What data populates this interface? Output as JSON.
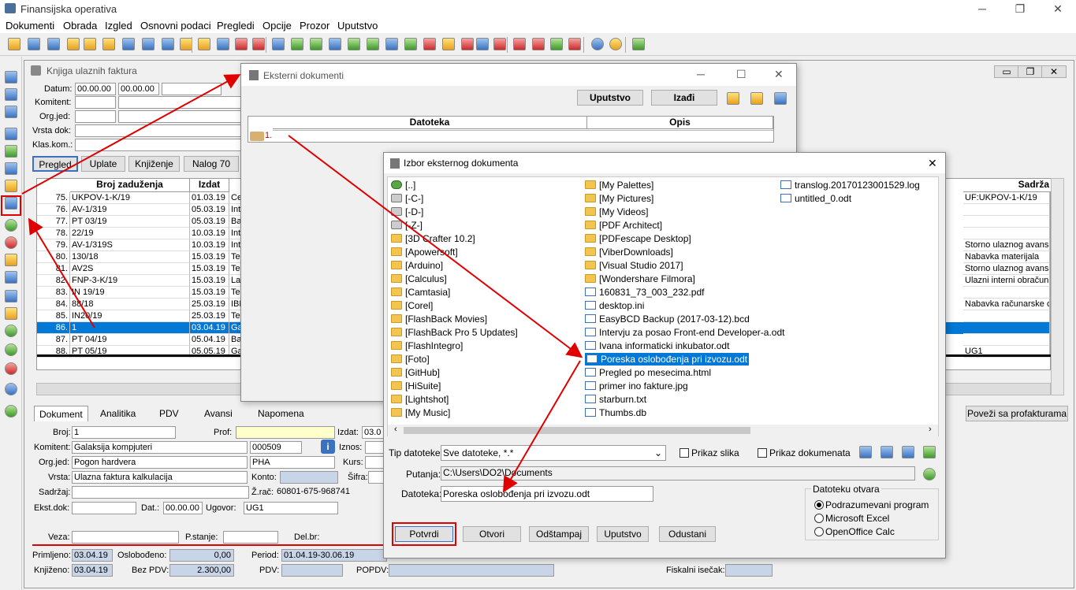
{
  "app": {
    "title": "Finansijska operativa",
    "win_min": "─",
    "win_max": "❐",
    "win_close": "✕"
  },
  "menu": [
    "Dokumenti",
    "Obrada",
    "Izgled",
    "Osnovni podaci",
    "Pregledi",
    "Opcije",
    "Prozor",
    "Uputstvo"
  ],
  "kuf": {
    "title": "Knjiga ulaznih faktura",
    "filter": {
      "datum_label": "Datum:",
      "datum_from": "00.00.00",
      "datum_to": "00.00.00",
      "komitent_label": "Komitent:",
      "orgjed_label": "Org.jed:",
      "vrsta_label": "Vrsta dok:",
      "klas_label": "Klas.kom.:"
    },
    "buttons": [
      "Pregled",
      "Uplate",
      "Knjiženje",
      "Nalog 70"
    ],
    "columns": {
      "broj": "Broj zaduženja",
      "izdat": "Izdat",
      "sadrzaj": "Sadrža"
    },
    "rows": [
      {
        "n": "75.",
        "broj": "UKPOV-1-K/19",
        "izdat": "01.03.19",
        "k": "Cer",
        "s": "UF:UKPOV-1-K/19"
      },
      {
        "n": "76.",
        "broj": "AV-1/319",
        "izdat": "05.03.19",
        "k": "Inte",
        "s": ""
      },
      {
        "n": "77.",
        "broj": "PT 03/19",
        "izdat": "05.03.19",
        "k": "Ban",
        "s": ""
      },
      {
        "n": "78.",
        "broj": "22/19",
        "izdat": "10.03.19",
        "k": "Inte",
        "s": ""
      },
      {
        "n": "79.",
        "broj": "AV-1/319S",
        "izdat": "10.03.19",
        "k": "Inte",
        "s": "Storno ulaznog avansa"
      },
      {
        "n": "80.",
        "broj": "130/18",
        "izdat": "15.03.19",
        "k": "Teh",
        "s": "Nabavka materijala"
      },
      {
        "n": "81.",
        "broj": "AV2S",
        "izdat": "15.03.19",
        "k": "Teh",
        "s": "Storno ulaznog avansa"
      },
      {
        "n": "82.",
        "broj": "FNP-3-K/19",
        "izdat": "15.03.19",
        "k": "Lar",
        "s": "Ulazni interni obračun P"
      },
      {
        "n": "83.",
        "broj": "IN 19/19",
        "izdat": "15.03.19",
        "k": "Teh",
        "s": ""
      },
      {
        "n": "84.",
        "broj": "88/18",
        "izdat": "25.03.19",
        "k": "IBM",
        "s": "Nabavka računarske op"
      },
      {
        "n": "85.",
        "broj": "IN20/19",
        "izdat": "25.03.19",
        "k": "Teh",
        "s": ""
      },
      {
        "n": "86.",
        "broj": "1",
        "izdat": "03.04.19",
        "k": "Gal",
        "s": ""
      },
      {
        "n": "87.",
        "broj": "PT 04/19",
        "izdat": "05.04.19",
        "k": "Ban",
        "s": ""
      },
      {
        "n": "88.",
        "broj": "PT 05/19",
        "izdat": "05.05.19",
        "k": "Gal",
        "s": "UG1"
      }
    ],
    "tabs": [
      "Dokument",
      "Analitika",
      "PDV",
      "Avansi",
      "Napomena"
    ],
    "povezi_btn": "Poveži sa profakturama",
    "form": {
      "broj_label": "Broj:",
      "broj": "1",
      "prof_label": "Prof:",
      "izdat_label": "Izdat:",
      "izdat": "03.0",
      "komitent_label": "Komitent:",
      "komitent": "Galaksija kompjuteri",
      "komitent_code": "000509",
      "iznos_label": "Iznos:",
      "orgjed_label": "Org.jed:",
      "orgjed": "Pogon hardvera",
      "orgjed_code": "PHA",
      "kurs_label": "Kurs:",
      "vrsta_label": "Vrsta:",
      "vrsta": "Ulazna faktura kalkulacija",
      "konto_label": "Konto:",
      "sifra_label": "Šifra:",
      "sadrzaj_label": "Sadržaj:",
      "zrac_label": "Ž.rač:",
      "zrac": "60801-675-968741",
      "ekst_label": "Ekst.dok:",
      "dat_label": "Dat.:",
      "dat": "00.00.00",
      "ugovor_label": "Ugovor:",
      "ugovor": "UG1",
      "veza_label": "Veza:",
      "pstanje_label": "P.stanje:",
      "delbr_label": "Del.br:",
      "primljeno_label": "Primljeno:",
      "primljeno": "03.04.19",
      "oslobodjeno_label": "Oslobođeno:",
      "oslobodjeno": "0,00",
      "period_label": "Period:",
      "period": "01.04.19-30.06.19",
      "knjizeno_label": "Knjiženo:",
      "knjizeno": "03.04.19",
      "bezpdv_label": "Bez PDV:",
      "bezpdv": "2.300,00",
      "pdv_label": "PDV:",
      "popdv_label": "POPDV:",
      "fiskalni_label": "Fiskalni isečak:"
    }
  },
  "eksterni": {
    "title": "Eksterni dokumenti",
    "buttons": [
      "Uputstvo",
      "Izađi"
    ],
    "col_datoteka": "Datoteka",
    "col_opis": "Opis",
    "row_num": "1."
  },
  "izbor": {
    "title": "Izbor eksternog dokumenta",
    "col1": [
      [
        "up",
        "[..]"
      ],
      [
        "drive",
        "[-C-]"
      ],
      [
        "drive",
        "[-D-]"
      ],
      [
        "drive",
        "[-Z-]"
      ],
      [
        "folder",
        "[3D Crafter 10.2]"
      ],
      [
        "folder",
        "[Apowersoft]"
      ],
      [
        "folder",
        "[Arduino]"
      ],
      [
        "folder",
        "[Calculus]"
      ],
      [
        "folder",
        "[Camtasia]"
      ],
      [
        "folder",
        "[Corel]"
      ],
      [
        "folder",
        "[FlashBack Movies]"
      ],
      [
        "folder",
        "[FlashBack Pro 5 Updates]"
      ],
      [
        "folder",
        "[FlashIntegro]"
      ],
      [
        "folder",
        "[Foto]"
      ],
      [
        "folder",
        "[GitHub]"
      ],
      [
        "folder",
        "[HiSuite]"
      ],
      [
        "folder",
        "[Lightshot]"
      ],
      [
        "folder",
        "[My Music]"
      ]
    ],
    "col2": [
      [
        "folder",
        "[My Palettes]"
      ],
      [
        "folder",
        "[My Pictures]"
      ],
      [
        "folder",
        "[My Videos]"
      ],
      [
        "folder",
        "[PDF Architect]"
      ],
      [
        "folder",
        "[PDFescape Desktop]"
      ],
      [
        "folder",
        "[ViberDownloads]"
      ],
      [
        "folder",
        "[Visual Studio 2017]"
      ],
      [
        "folder",
        "[Wondershare Filmora]"
      ],
      [
        "doc",
        "160831_73_003_232.pdf"
      ],
      [
        "doc",
        "desktop.ini"
      ],
      [
        "doc",
        "EasyBCD Backup (2017-03-12).bcd"
      ],
      [
        "doc",
        "Intervju za posao Front-end Developer-a.odt"
      ],
      [
        "doc",
        "Ivana informaticki inkubator.odt"
      ],
      [
        "doc",
        "Poreska oslobođenja pri izvozu.odt"
      ],
      [
        "doc",
        "Pregled po mesecima.html"
      ],
      [
        "doc",
        "primer ino fakture.jpg"
      ],
      [
        "doc",
        "starburn.txt"
      ],
      [
        "doc",
        "Thumbs.db"
      ]
    ],
    "col3": [
      [
        "doc",
        "translog.20170123001529.log"
      ],
      [
        "doc",
        "untitled_0.odt"
      ]
    ],
    "tip_label": "Tip datoteke:",
    "tip_value": "Sve datoteke, *.*",
    "prikaz_slika": "Prikaz slika",
    "prikaz_dok": "Prikaz dokumenata",
    "putanja_label": "Putanja:",
    "putanja": "C:\\Users\\DO2\\Documents",
    "datoteka_label": "Datoteka:",
    "datoteka": "Poreska oslobođenja pri izvozu.odt",
    "otvara_label": "Datoteku otvara",
    "otvara_opts": [
      "Podrazumevani program",
      "Microsoft Excel",
      "OpenOffice Calc"
    ],
    "buttons": [
      "Potvrdi",
      "Otvori",
      "Odštampaj",
      "Uputstvo",
      "Odustani"
    ]
  },
  "colors": {
    "selection": "#0078d7",
    "highlight": "#e00000"
  }
}
